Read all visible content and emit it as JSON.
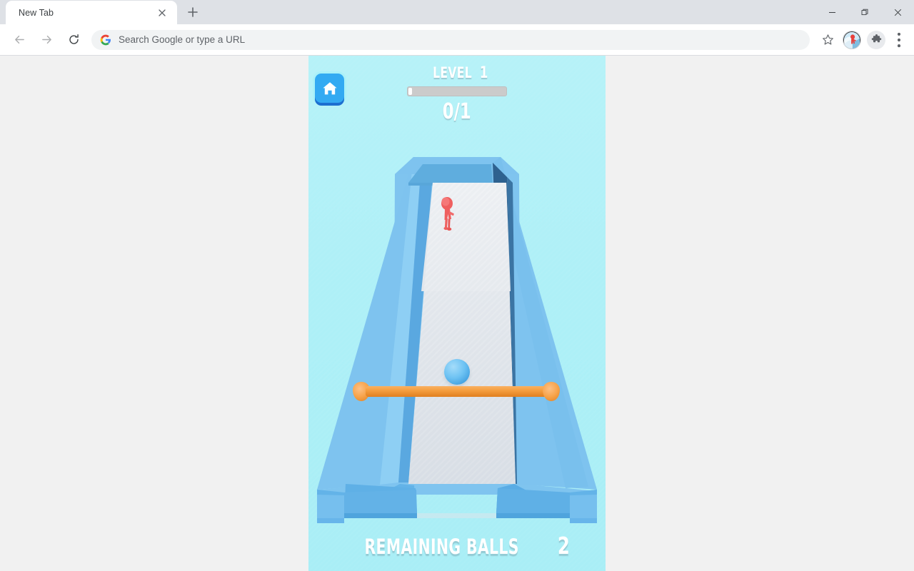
{
  "browser": {
    "tab": {
      "title": "New Tab",
      "close_icon": "close-icon"
    },
    "new_tab_icon": "plus-icon",
    "window_controls": {
      "minimize": "minimize-icon",
      "maximize": "maximize-restore-icon",
      "close": "close-icon"
    },
    "toolbar": {
      "back_icon": "arrow-back-icon",
      "forward_icon": "arrow-forward-icon",
      "reload_icon": "reload-icon",
      "omnibox_text": "Search Google or type a URL",
      "omnibox_leading_icon": "google-g-icon",
      "bookmark_icon": "star-icon",
      "profile_icon": "avatar",
      "extensions_icon": "puzzle-piece-icon",
      "menu_icon": "three-dots-vertical-icon"
    }
  },
  "game": {
    "home_button": {
      "icon": "home-icon",
      "color": "#33aaf2"
    },
    "hud": {
      "level_label": "LEVEL",
      "level_value": "1",
      "progress_percent": 4,
      "score": "0/1"
    },
    "bottom": {
      "remaining_label": "REMAINING BALLS",
      "remaining_value": "2"
    },
    "colors": {
      "background_top": "#b6f2f8",
      "background_bottom": "#a9eef6",
      "wall_light": "#7fc4ef",
      "wall_mid": "#4e9fdd",
      "wall_dark": "#2e618f",
      "wall_top": "#8fcef2",
      "floor": "#dfe4ea",
      "ball": "#6fc3f3",
      "paddle": "#f59e3f",
      "character": "#ef5f5f"
    },
    "objects": {
      "ball_name": "game-ball",
      "paddle_name": "game-paddle",
      "character_name": "red-character"
    }
  }
}
